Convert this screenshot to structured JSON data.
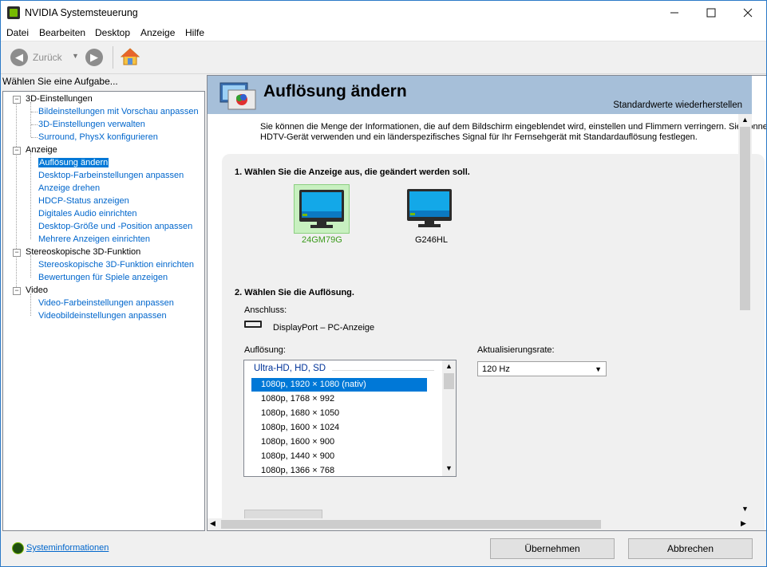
{
  "window": {
    "title": "NVIDIA Systemsteuerung"
  },
  "menu": [
    "Datei",
    "Bearbeiten",
    "Desktop",
    "Anzeige",
    "Hilfe"
  ],
  "toolbar": {
    "back_label": "Zurück"
  },
  "left": {
    "header": "Wählen Sie eine Aufgabe...",
    "categories": [
      {
        "label": "3D-Einstellungen",
        "items": [
          "Bildeinstellungen mit Vorschau anpassen",
          "3D-Einstellungen verwalten",
          "Surround, PhysX konfigurieren"
        ]
      },
      {
        "label": "Anzeige",
        "items": [
          "Auflösung ändern",
          "Desktop-Farbeinstellungen anpassen",
          "Anzeige drehen",
          "HDCP-Status anzeigen",
          "Digitales Audio einrichten",
          "Desktop-Größe und -Position anpassen",
          "Mehrere Anzeigen einrichten"
        ]
      },
      {
        "label": "Stereoskopische 3D-Funktion",
        "items": [
          "Stereoskopische 3D-Funktion einrichten",
          "Bewertungen für Spiele anzeigen"
        ]
      },
      {
        "label": "Video",
        "items": [
          "Video-Farbeinstellungen anpassen",
          "Videobildeinstellungen anpassen"
        ]
      }
    ]
  },
  "page": {
    "title": "Auflösung ändern",
    "restore": "Standardwerte wiederherstellen",
    "description_1": "Sie können die Menge der Informationen, die auf dem Bildschirm eingeblendet wird, einstellen und Flimmern verringern. Sie können",
    "description_2": "HDTV-Gerät verwenden und ein länderspezifisches Signal für Ihr Fernsehgerät mit Standardauflösung festlegen.",
    "section1": "1. Wählen Sie die Anzeige aus, die geändert werden soll.",
    "monitors": [
      {
        "name": "24GM79G"
      },
      {
        "name": "G246HL"
      }
    ],
    "section2": "2. Wählen Sie die Auflösung.",
    "connection_label": "Anschluss:",
    "connection_value": "DisplayPort – PC-Anzeige",
    "resolution_label": "Auflösung:",
    "refresh_label": "Aktualisierungsrate:",
    "refresh_value": "120 Hz",
    "resolution_group": "Ultra-HD, HD, SD",
    "resolutions": [
      "1080p, 1920 × 1080 (nativ)",
      "1080p, 1768 × 992",
      "1080p, 1680 × 1050",
      "1080p, 1600 × 1024",
      "1080p, 1600 × 900",
      "1080p, 1440 × 900",
      "1080p, 1366 × 768"
    ]
  },
  "footer": {
    "sysinfo": "Systeminformationen",
    "apply": "Übernehmen",
    "cancel": "Abbrechen"
  },
  "colors": {
    "accent": "#0078d7",
    "nvidia_green": "#76b900",
    "header_band": "#a6bfd9",
    "link": "#0066cc"
  }
}
